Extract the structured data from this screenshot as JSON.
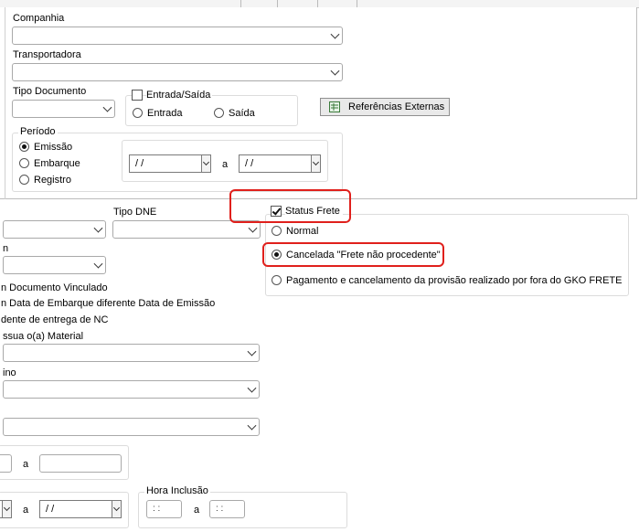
{
  "top": {
    "companhia_label": "Companhia",
    "transportadora_label": "Transportadora",
    "tipo_documento_label": "Tipo Documento",
    "entrada_saida": {
      "label": "Entrada/Saída",
      "checked": false,
      "options": [
        "Entrada",
        "Saída"
      ]
    },
    "referencias_button": "Referências Externas",
    "periodo": {
      "label": "Período",
      "options": [
        "Emissão",
        "Embarque",
        "Registro"
      ],
      "selected": "Emissão",
      "date_from": "/ /",
      "separator": "a",
      "date_to": "/ /"
    }
  },
  "lower": {
    "tipo_dne_label": "Tipo DNE",
    "checks_text": [
      "n Documento Vinculado",
      "n Data de Embarque diferente Data de Emissão",
      "dente de entrega de NC"
    ],
    "material_label": "ssua o(a) Material",
    "destino_label": "ino",
    "truncated_label": "n",
    "range_separator": "a",
    "date_value": "/ /",
    "hora_inclusao": {
      "label": "Hora Inclusão",
      "from": ": :",
      "separator": "a",
      "to": ": :"
    }
  },
  "status_frete": {
    "label": "Status Frete",
    "checked": true,
    "options": [
      "Normal",
      "Cancelada \"Frete não procedente\"",
      "Pagamento e cancelamento da provisão realizado por fora do GKO FRETE"
    ],
    "selected": "Cancelada \"Frete não procedente\""
  },
  "colors": {
    "highlight": "#e0201c",
    "border": "#a9a9a9"
  }
}
